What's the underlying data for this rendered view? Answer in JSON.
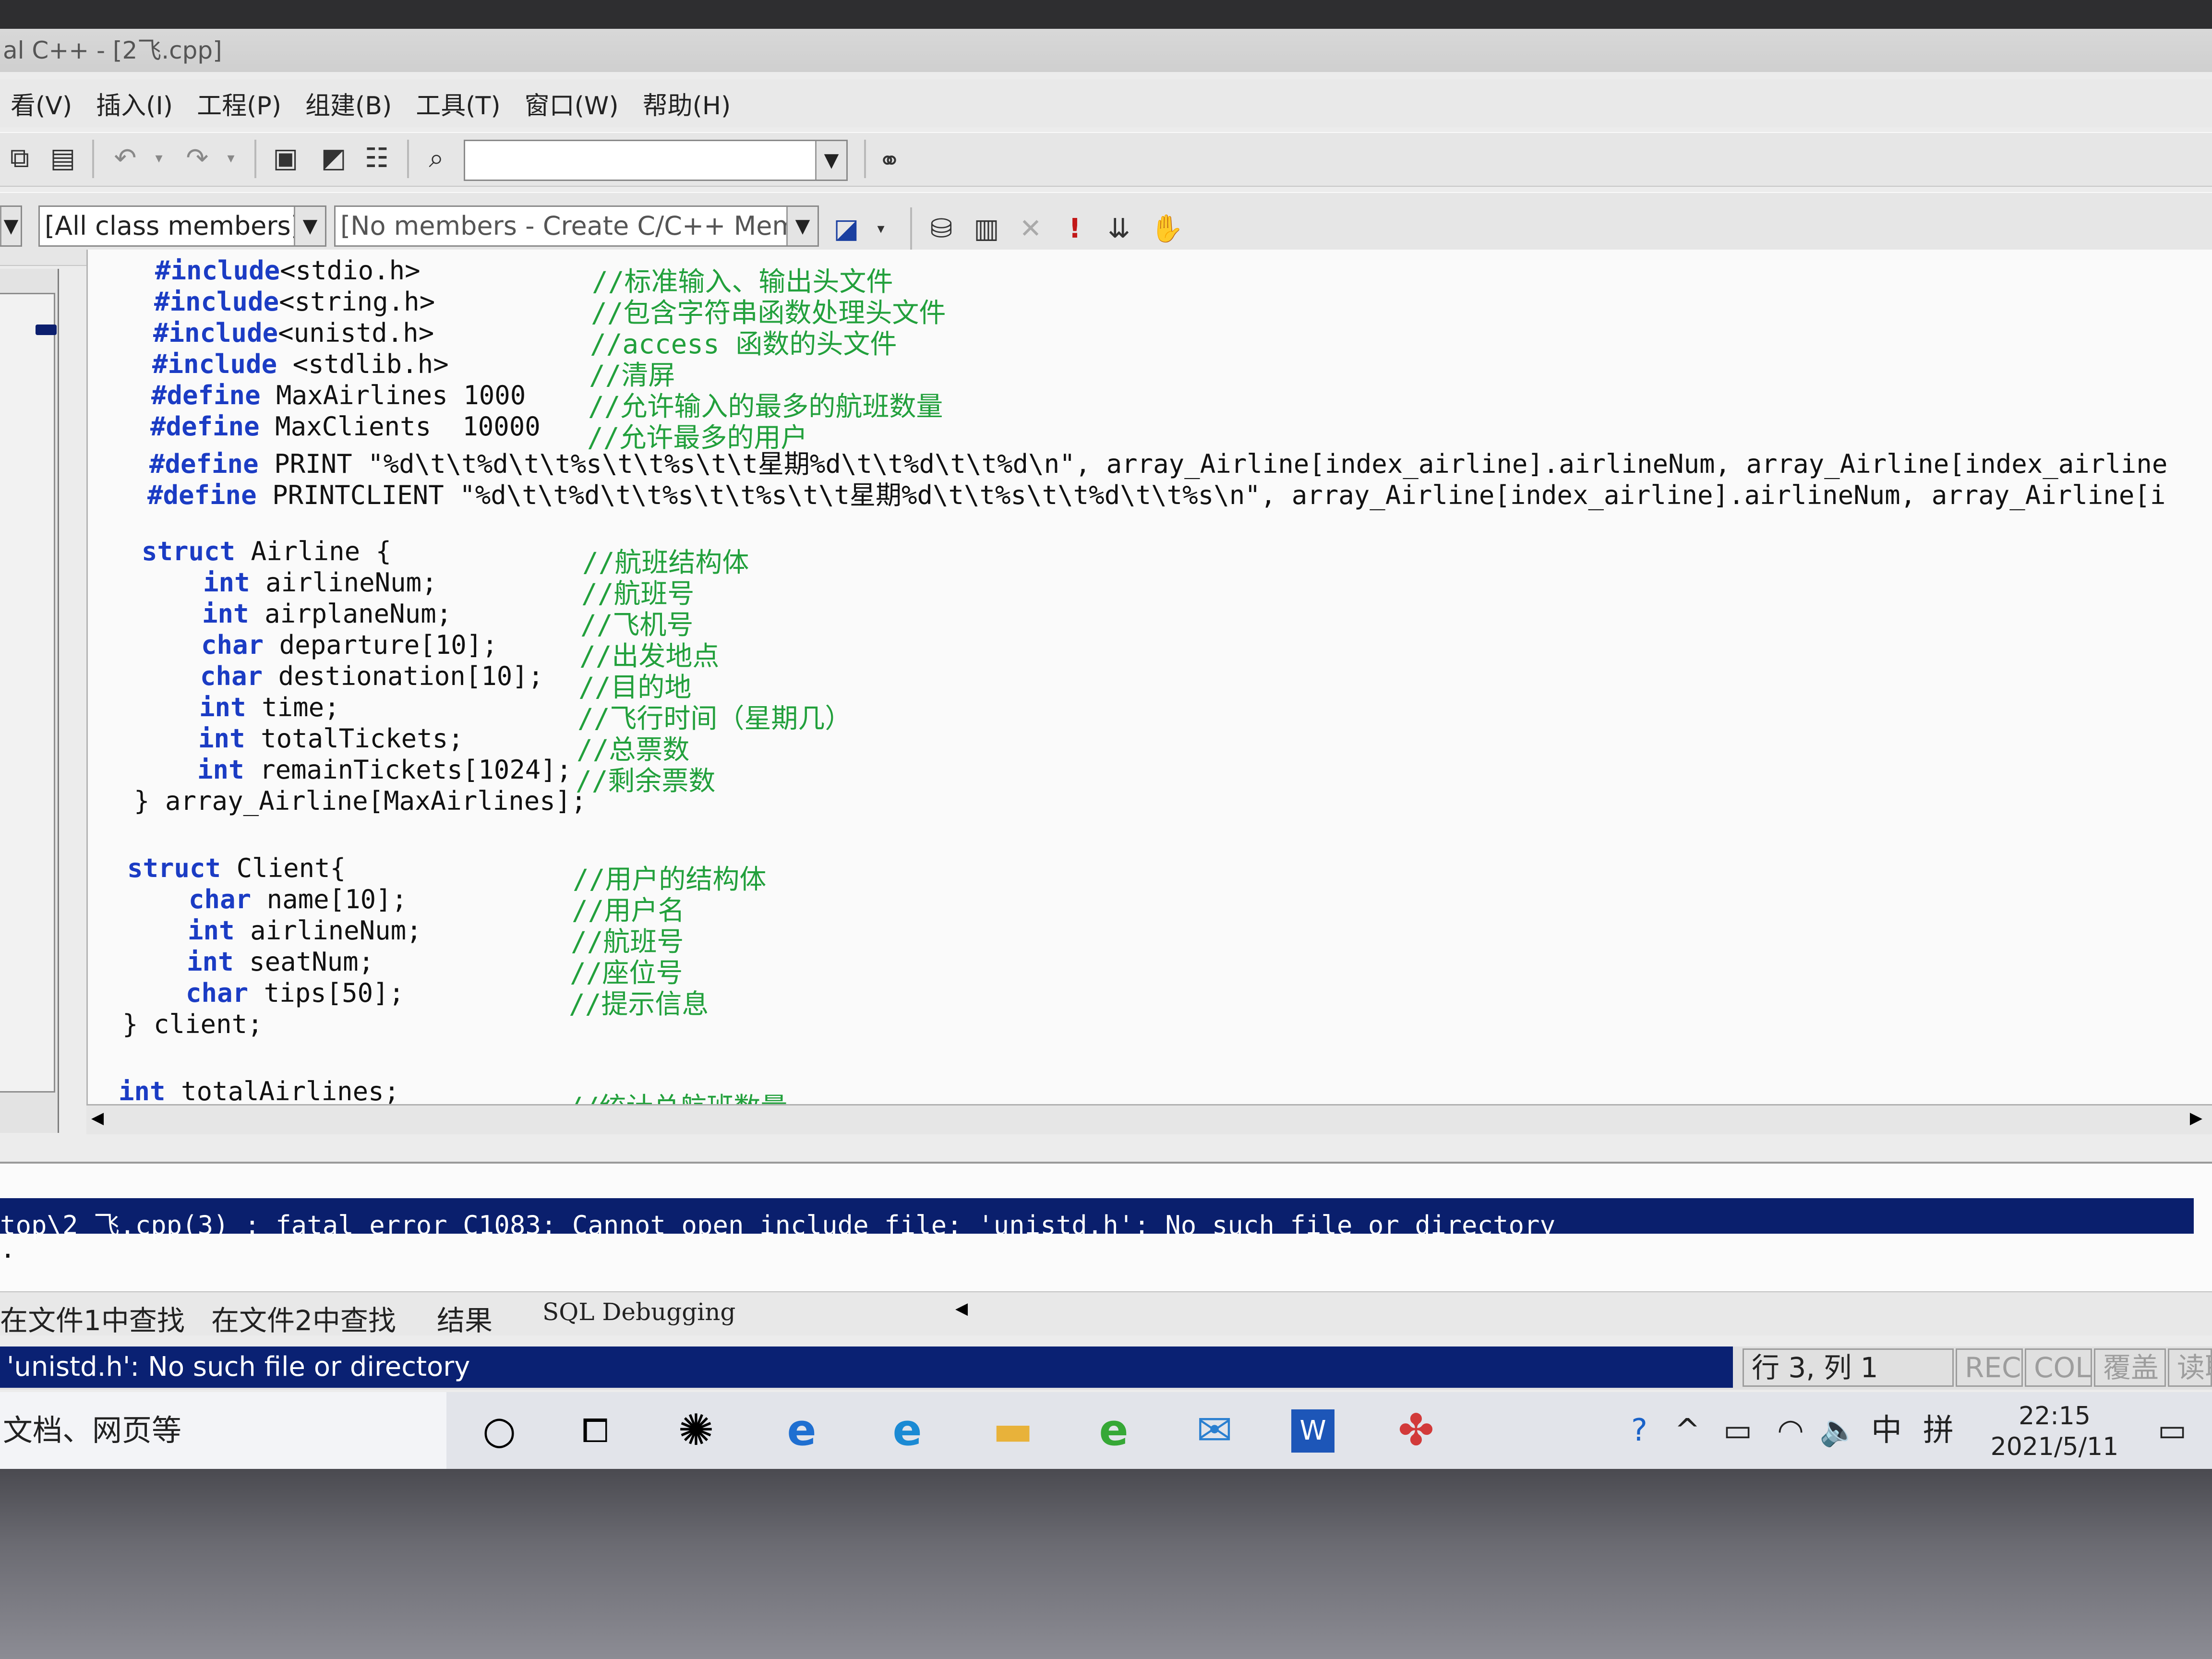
{
  "window": {
    "title": "al C++ - [2飞.cpp]"
  },
  "menu": [
    "看(V)",
    "插入(I)",
    "工程(P)",
    "组建(B)",
    "工具(T)",
    "窗口(W)",
    "帮助(H)"
  ],
  "toolbar": {
    "class_combo": "[All class members]",
    "members_combo": "[No members - Create C/C++ Memb"
  },
  "code": [
    {
      "kw": "#include",
      "rest": "<stdio.h>",
      "comment": "//标准输入、输出头文件"
    },
    {
      "kw": "#include",
      "rest": "<string.h>",
      "comment": "//包含字符串函数处理头文件"
    },
    {
      "kw": "#include",
      "rest": "<unistd.h>",
      "comment": "//access 函数的头文件"
    },
    {
      "kw": "#include",
      "rest": " <stdlib.h>",
      "comment": "//清屏"
    },
    {
      "kw": "#define",
      "rest": " MaxAirlines 1000",
      "comment": "//允许输入的最多的航班数量"
    },
    {
      "kw": "#define",
      "rest": " MaxClients  10000",
      "comment": "//允许最多的用户"
    },
    {
      "kw": "#define",
      "rest": " PRINT \"%d\\t\\t%d\\t\\t%s\\t\\t%s\\t\\t星期%d\\t\\t%d\\t\\t%d\\n\", array_Airline[index_airline].airlineNum, array_Airline[index_airline",
      "comment": ""
    },
    {
      "kw": "#define",
      "rest": " PRINTCLIENT \"%d\\t\\t%d\\t\\t%s\\t\\t%s\\t\\t星期%d\\t\\t%s\\t\\t%d\\t\\t%s\\n\", array_Airline[index_airline].airlineNum, array_Airline[i",
      "comment": ""
    },
    {
      "kw": "",
      "rest": "",
      "comment": ""
    },
    {
      "kw": "struct",
      "rest": " Airline {",
      "comment": "//航班结构体"
    },
    {
      "kw": "    int",
      "rest": " airlineNum;",
      "comment": "//航班号"
    },
    {
      "kw": "    int",
      "rest": " airplaneNum;",
      "comment": "//飞机号"
    },
    {
      "kw": "    char",
      "rest": " departure[10];",
      "comment": "//出发地点"
    },
    {
      "kw": "    char",
      "rest": " destionation[10];",
      "comment": "//目的地"
    },
    {
      "kw": "    int",
      "rest": " time;",
      "comment": "//飞行时间（星期几）"
    },
    {
      "kw": "    int",
      "rest": " totalTickets;",
      "comment": "//总票数"
    },
    {
      "kw": "    int",
      "rest": " remainTickets[1024];",
      "comment": "//剩余票数"
    },
    {
      "kw": "",
      "rest": "} array_Airline[MaxAirlines];",
      "comment": ""
    },
    {
      "kw": "",
      "rest": "",
      "comment": ""
    },
    {
      "kw": "struct",
      "rest": " Client{",
      "comment": "//用户的结构体"
    },
    {
      "kw": "    char",
      "rest": " name[10];",
      "comment": "//用户名"
    },
    {
      "kw": "    int",
      "rest": " airlineNum;",
      "comment": "//航班号"
    },
    {
      "kw": "    int",
      "rest": " seatNum;",
      "comment": "//座位号"
    },
    {
      "kw": "    char",
      "rest": " tips[50];",
      "comment": "//提示信息"
    },
    {
      "kw": "",
      "rest": "} client;",
      "comment": ""
    },
    {
      "kw": "",
      "rest": "",
      "comment": ""
    },
    {
      "kw": "int",
      "rest": " totalAirlines;",
      "comment": "//统计总航班数量"
    }
  ],
  "output": {
    "error_line": "top\\2 飞.cpp(3) : fatal error C1083: Cannot open include file: 'unistd.h': No such file or directory",
    "second_line": "."
  },
  "tabs": [
    "在文件1中查找",
    "在文件2中查找",
    "结果",
    "SQL Debugging"
  ],
  "status": {
    "message": "'unistd.h': No such file or directory",
    "position": "行 3, 列 1",
    "rec": "REC",
    "col": "COL",
    "ovr": "覆盖",
    "read": "读取"
  },
  "taskbar": {
    "search_text": "文档、网页等",
    "ime_lang": "中",
    "ime_mode": "拼",
    "time": "22:15",
    "date": "2021/5/11"
  },
  "colors": {
    "keyword": "#1b3cc4",
    "comment": "#22a03c",
    "highlight": "#0a1f6d"
  }
}
